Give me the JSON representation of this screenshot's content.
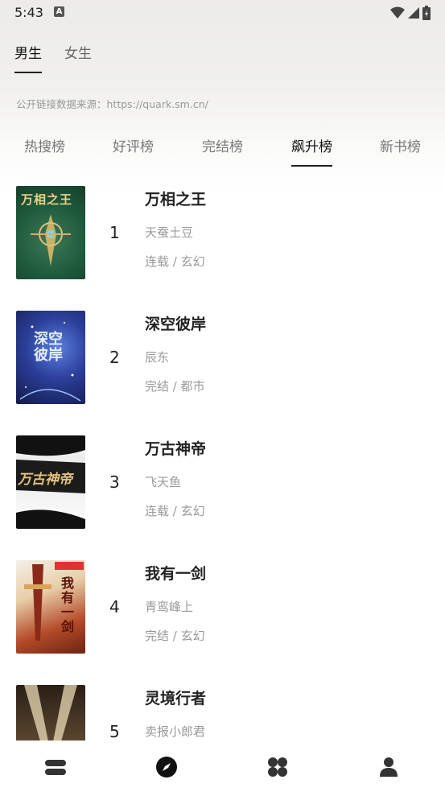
{
  "status_bar": {
    "time": "5:43",
    "a_label": "A"
  },
  "gender_tabs": [
    {
      "label": "男生",
      "active": true
    },
    {
      "label": "女生",
      "active": false
    }
  ],
  "source_text": "公开链接数据来源：https://quark.sm.cn/",
  "rank_tabs": [
    {
      "label": "热搜榜"
    },
    {
      "label": "好评榜"
    },
    {
      "label": "完结榜"
    },
    {
      "label": "飙升榜",
      "active": true
    },
    {
      "label": "新书榜"
    }
  ],
  "books": [
    {
      "rank": "1",
      "title": "万相之王",
      "author": "天蚕土豆",
      "meta": "连载 / 玄幻",
      "cover_text": "万相之王"
    },
    {
      "rank": "2",
      "title": "深空彼岸",
      "author": "辰东",
      "meta": "完结 / 都市",
      "cover_text": "深空彼岸"
    },
    {
      "rank": "3",
      "title": "万古神帝",
      "author": "飞天鱼",
      "meta": "连载 / 玄幻",
      "cover_text": "万古神帝"
    },
    {
      "rank": "4",
      "title": "我有一剑",
      "author": "青鸾峰上",
      "meta": "完结 / 玄幻",
      "cover_text": "我有一剑"
    },
    {
      "rank": "5",
      "title": "灵境行者",
      "author": "卖报小郎君",
      "meta": "",
      "cover_text": ""
    }
  ],
  "bottom_nav": [
    {
      "icon": "bookshelf-icon"
    },
    {
      "icon": "compass-icon",
      "active": true
    },
    {
      "icon": "apps-grid-icon"
    },
    {
      "icon": "profile-icon"
    }
  ],
  "colors": {
    "accent": "#222222",
    "muted": "#999999"
  }
}
